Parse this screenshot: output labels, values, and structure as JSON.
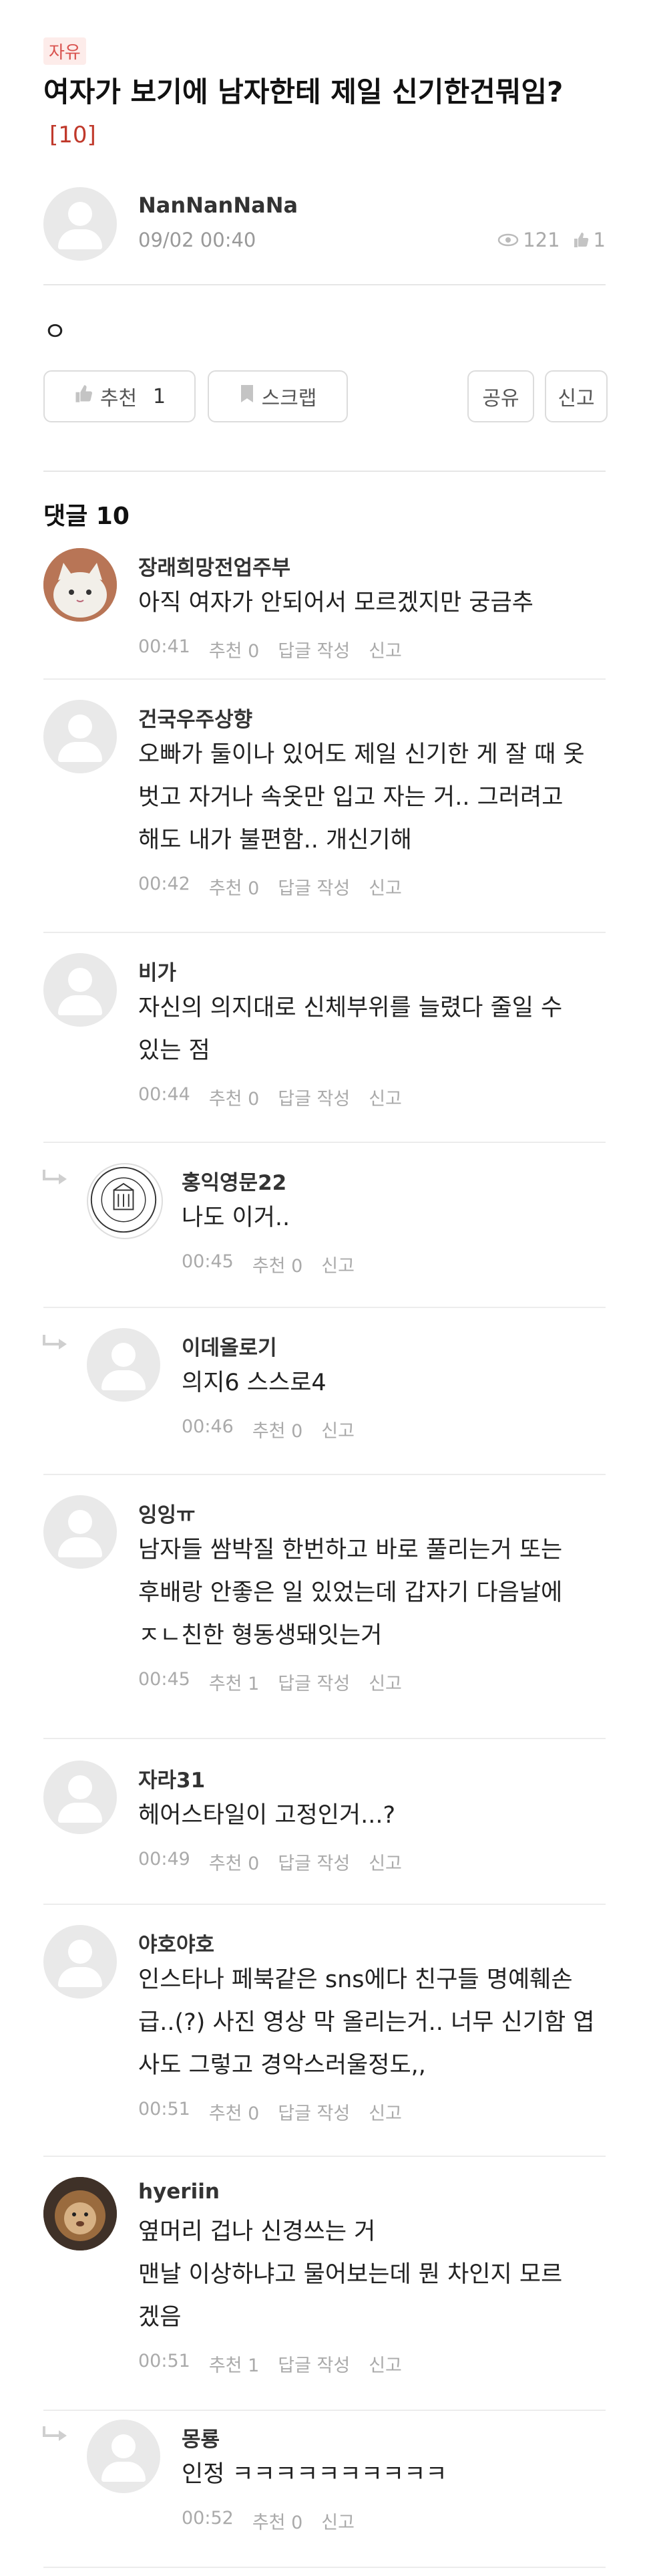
{
  "post": {
    "tag": "자유",
    "title": "여자가 보기에 남자한테 제일 신기한건뭐임?",
    "comment_count_badge": "[10]",
    "author": "NanNanNaNa",
    "date": "09/02 00:40",
    "views": "121",
    "likes": "1",
    "body": "ㅇ"
  },
  "actions": {
    "recommend_label": "추천",
    "recommend_count": "1",
    "scrap_label": "스크랩",
    "share_label": "공유",
    "report_label": "신고"
  },
  "comments_header": "댓글 10",
  "comments": [
    {
      "name": "장래희망전업주부",
      "lines": [
        "아직 여자가 안되어서 모르겠지만 궁금추"
      ],
      "time": "00:41",
      "recommend": "추천 0",
      "reply": "답글 작성",
      "report": "신고",
      "reply_level": 0,
      "avatar": "cat-photo"
    },
    {
      "name": "건국우주상향",
      "lines": [
        "오빠가 둘이나 있어도 제일 신기한 게 잘 때 옷",
        "벗고 자거나 속옷만 입고 자는 거.. 그러려고",
        "해도 내가 불편함.. 개신기해"
      ],
      "time": "00:42",
      "recommend": "추천 0",
      "reply": "답글 작성",
      "report": "신고",
      "reply_level": 0,
      "avatar": "default"
    },
    {
      "name": "비가",
      "lines": [
        "자신의 의지대로 신체부위를 늘렸다 줄일 수",
        "있는 점"
      ],
      "time": "00:44",
      "recommend": "추천 0",
      "reply": "답글 작성",
      "report": "신고",
      "reply_level": 0,
      "avatar": "default"
    },
    {
      "name": "홍익영문22",
      "lines": [
        "나도 이거.."
      ],
      "time": "00:45",
      "recommend": "추천 0",
      "reply": "",
      "report": "신고",
      "reply_level": 1,
      "avatar": "university-seal"
    },
    {
      "name": "이데올로기",
      "lines": [
        "의지6 스스로4"
      ],
      "time": "00:46",
      "recommend": "추천 0",
      "reply": "",
      "report": "신고",
      "reply_level": 1,
      "avatar": "default"
    },
    {
      "name": "잉잉ㅠ",
      "lines": [
        "남자들 쌈박질 한번하고 바로 풀리는거 또는",
        "후배랑 안좋은 일 있었는데 갑자기 다음날에",
        "ㅈㄴ친한 형동생돼잇는거"
      ],
      "time": "00:45",
      "recommend": "추천 1",
      "reply": "답글 작성",
      "report": "신고",
      "reply_level": 0,
      "avatar": "default"
    },
    {
      "name": "자라31",
      "lines": [
        "헤어스타일이 고정인거...?"
      ],
      "time": "00:49",
      "recommend": "추천 0",
      "reply": "답글 작성",
      "report": "신고",
      "reply_level": 0,
      "avatar": "default"
    },
    {
      "name": "야호야호",
      "lines": [
        "인스타나 페북같은 sns에다 친구들 명예훼손",
        "급..(?) 사진 영상 막 올리는거.. 너무 신기함 엽",
        "사도 그렇고 경악스러울정도,,"
      ],
      "time": "00:51",
      "recommend": "추천 0",
      "reply": "답글 작성",
      "report": "신고",
      "reply_level": 0,
      "avatar": "default"
    },
    {
      "name": "hyeriin",
      "lines": [
        "옆머리 겁나 신경쓰는 거",
        "맨날 이상하냐고 물어보는데 뭔 차인지 모르",
        "겠음"
      ],
      "time": "00:51",
      "recommend": "추천 1",
      "reply": "답글 작성",
      "report": "신고",
      "reply_level": 0,
      "avatar": "lion-photo"
    },
    {
      "name": "몽룡",
      "lines": [
        "인정 ㅋㅋㅋㅋㅋㅋㅋㅋㅋㅋ"
      ],
      "time": "00:52",
      "recommend": "추천 0",
      "reply": "",
      "report": "신고",
      "reply_level": 1,
      "avatar": "default"
    }
  ],
  "colors": {
    "accent": "#c0392b",
    "meta": "#aaaaaa",
    "divider": "#e6e6e6"
  }
}
